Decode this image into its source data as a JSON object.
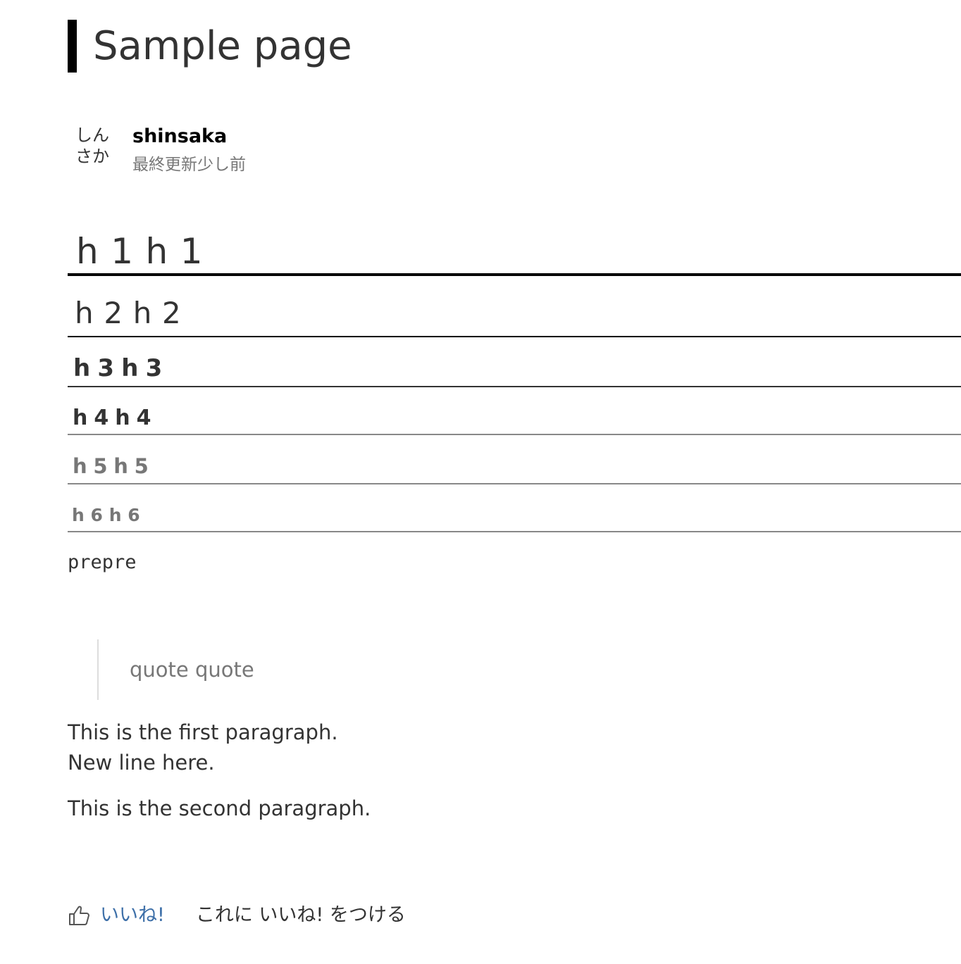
{
  "page": {
    "title": "Sample page"
  },
  "author": {
    "avatar_line1": "しん",
    "avatar_line2": "さか",
    "name": "shinsaka",
    "updated": "最終更新少し前"
  },
  "headings": {
    "h1": "h1h1",
    "h2": "h2h2",
    "h3": "h3h3",
    "h4": "h4h4",
    "h5": "h5h5",
    "h6": "h6h6"
  },
  "pre": "prepre",
  "quote": "quote quote",
  "paragraphs": {
    "first_line1": "This is the first paragraph.",
    "first_line2": "New line here.",
    "second": "This is the second paragraph."
  },
  "like": {
    "icon": "thumbs-up-icon",
    "label": "いいね!",
    "prompt": "これに いいね! をつける",
    "accent_color": "#3d6fa8"
  }
}
